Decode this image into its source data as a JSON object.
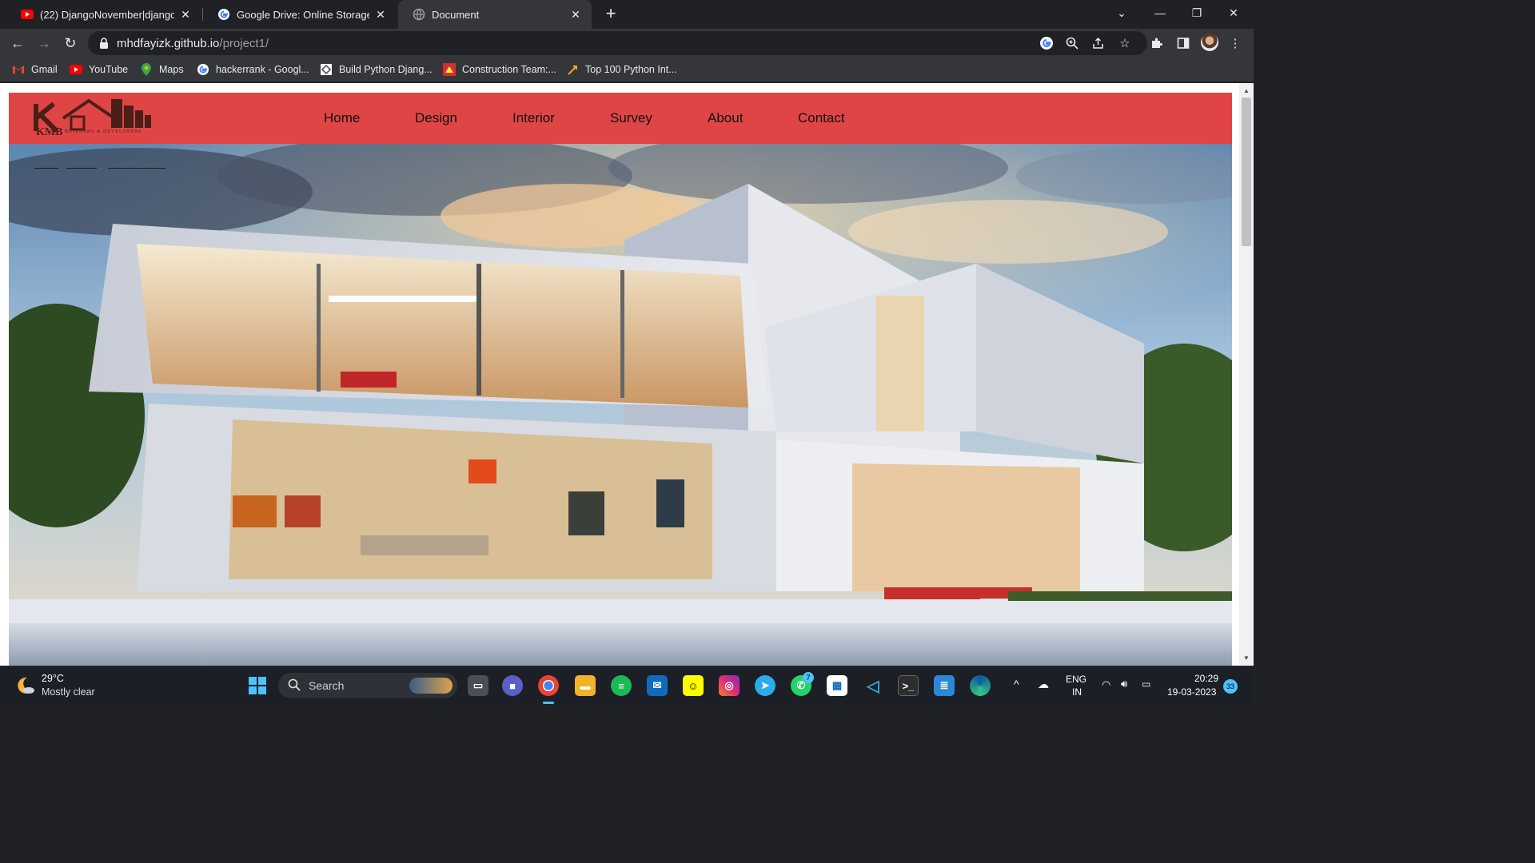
{
  "browser": {
    "tabs": [
      {
        "title": "(22) DjangoNovember|django ta",
        "icon": "youtube-icon",
        "active": false
      },
      {
        "title": "Google Drive: Online Storage for",
        "icon": "google-icon",
        "active": false
      },
      {
        "title": "Document",
        "icon": "globe-icon",
        "active": true
      }
    ],
    "url_host": "mhdfayizk.github.io",
    "url_path": "/project1/",
    "bookmarks": [
      {
        "label": "Gmail",
        "icon": "gmail-icon"
      },
      {
        "label": "YouTube",
        "icon": "youtube-icon"
      },
      {
        "label": "Maps",
        "icon": "maps-icon"
      },
      {
        "label": "hackerrank - Googl...",
        "icon": "google-icon"
      },
      {
        "label": "Build Python Djang...",
        "icon": "site-icon"
      },
      {
        "label": "Construction Team:...",
        "icon": "construction-icon"
      },
      {
        "label": "Top 100 Python Int...",
        "icon": "python-icon"
      }
    ]
  },
  "site": {
    "logo_text": "KMB",
    "logo_subtext": "BUILDERS & DEVELOPERS",
    "menu": [
      "Home",
      "Design",
      "Interior",
      "Survey",
      "About",
      "Contact"
    ],
    "colors": {
      "nav_bg": "#e04545",
      "nav_text": "#111111"
    }
  },
  "taskbar": {
    "weather_temp": "29°C",
    "weather_desc": "Mostly clear",
    "search_label": "Search",
    "language": "ENG",
    "region": "IN",
    "time": "20:29",
    "date": "19-03-2023",
    "notification_count": "33",
    "whatsapp_badge": "7"
  }
}
